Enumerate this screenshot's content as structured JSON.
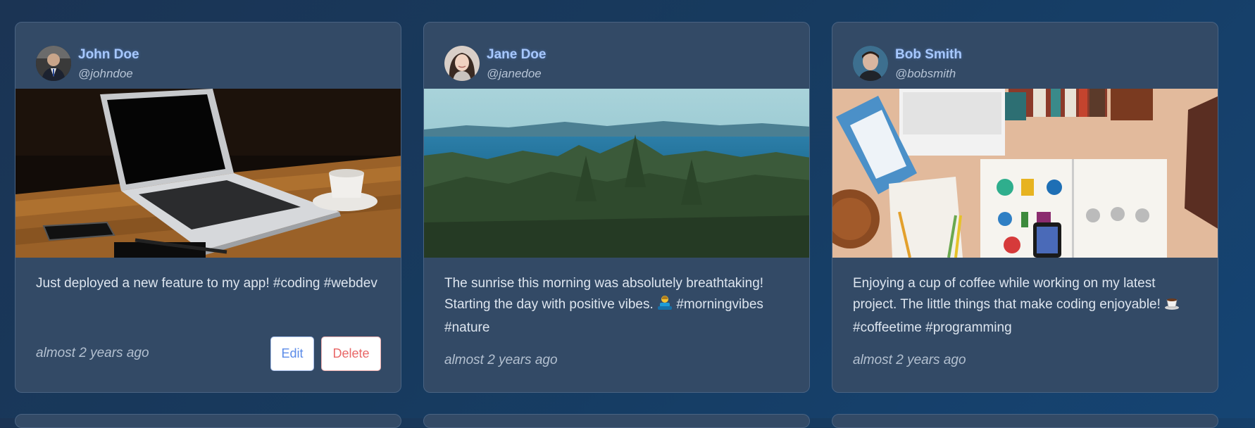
{
  "posts": [
    {
      "name": "John Doe",
      "handle": "@johndoe",
      "text": "Just deployed a new feature to my app! #coding #webdev",
      "time": "almost 2 years ago",
      "edit_label": "Edit",
      "delete_label": "Delete"
    },
    {
      "name": "Jane Doe",
      "handle": "@janedoe",
      "text_before_emoji": "The sunrise this morning was absolutely breathtaking! Starting the day with positive vibes. ",
      "text_after_emoji": " #morningvibes #nature",
      "emoji": "person-in-lotus-position-icon",
      "time": "almost 2 years ago"
    },
    {
      "name": "Bob Smith",
      "handle": "@bobsmith",
      "text_before_emoji": "Enjoying a cup of coffee while working on my latest project. The little things that make coding enjoyable! ",
      "text_after_emoji": " #coffeetime #programming",
      "emoji": "coffee-cup-icon",
      "time": "almost 2 years ago"
    }
  ],
  "colors": {
    "card_bg": "#334a66",
    "name": "#a7c8ff",
    "edit": "#5b8be8",
    "delete": "#e86767"
  }
}
